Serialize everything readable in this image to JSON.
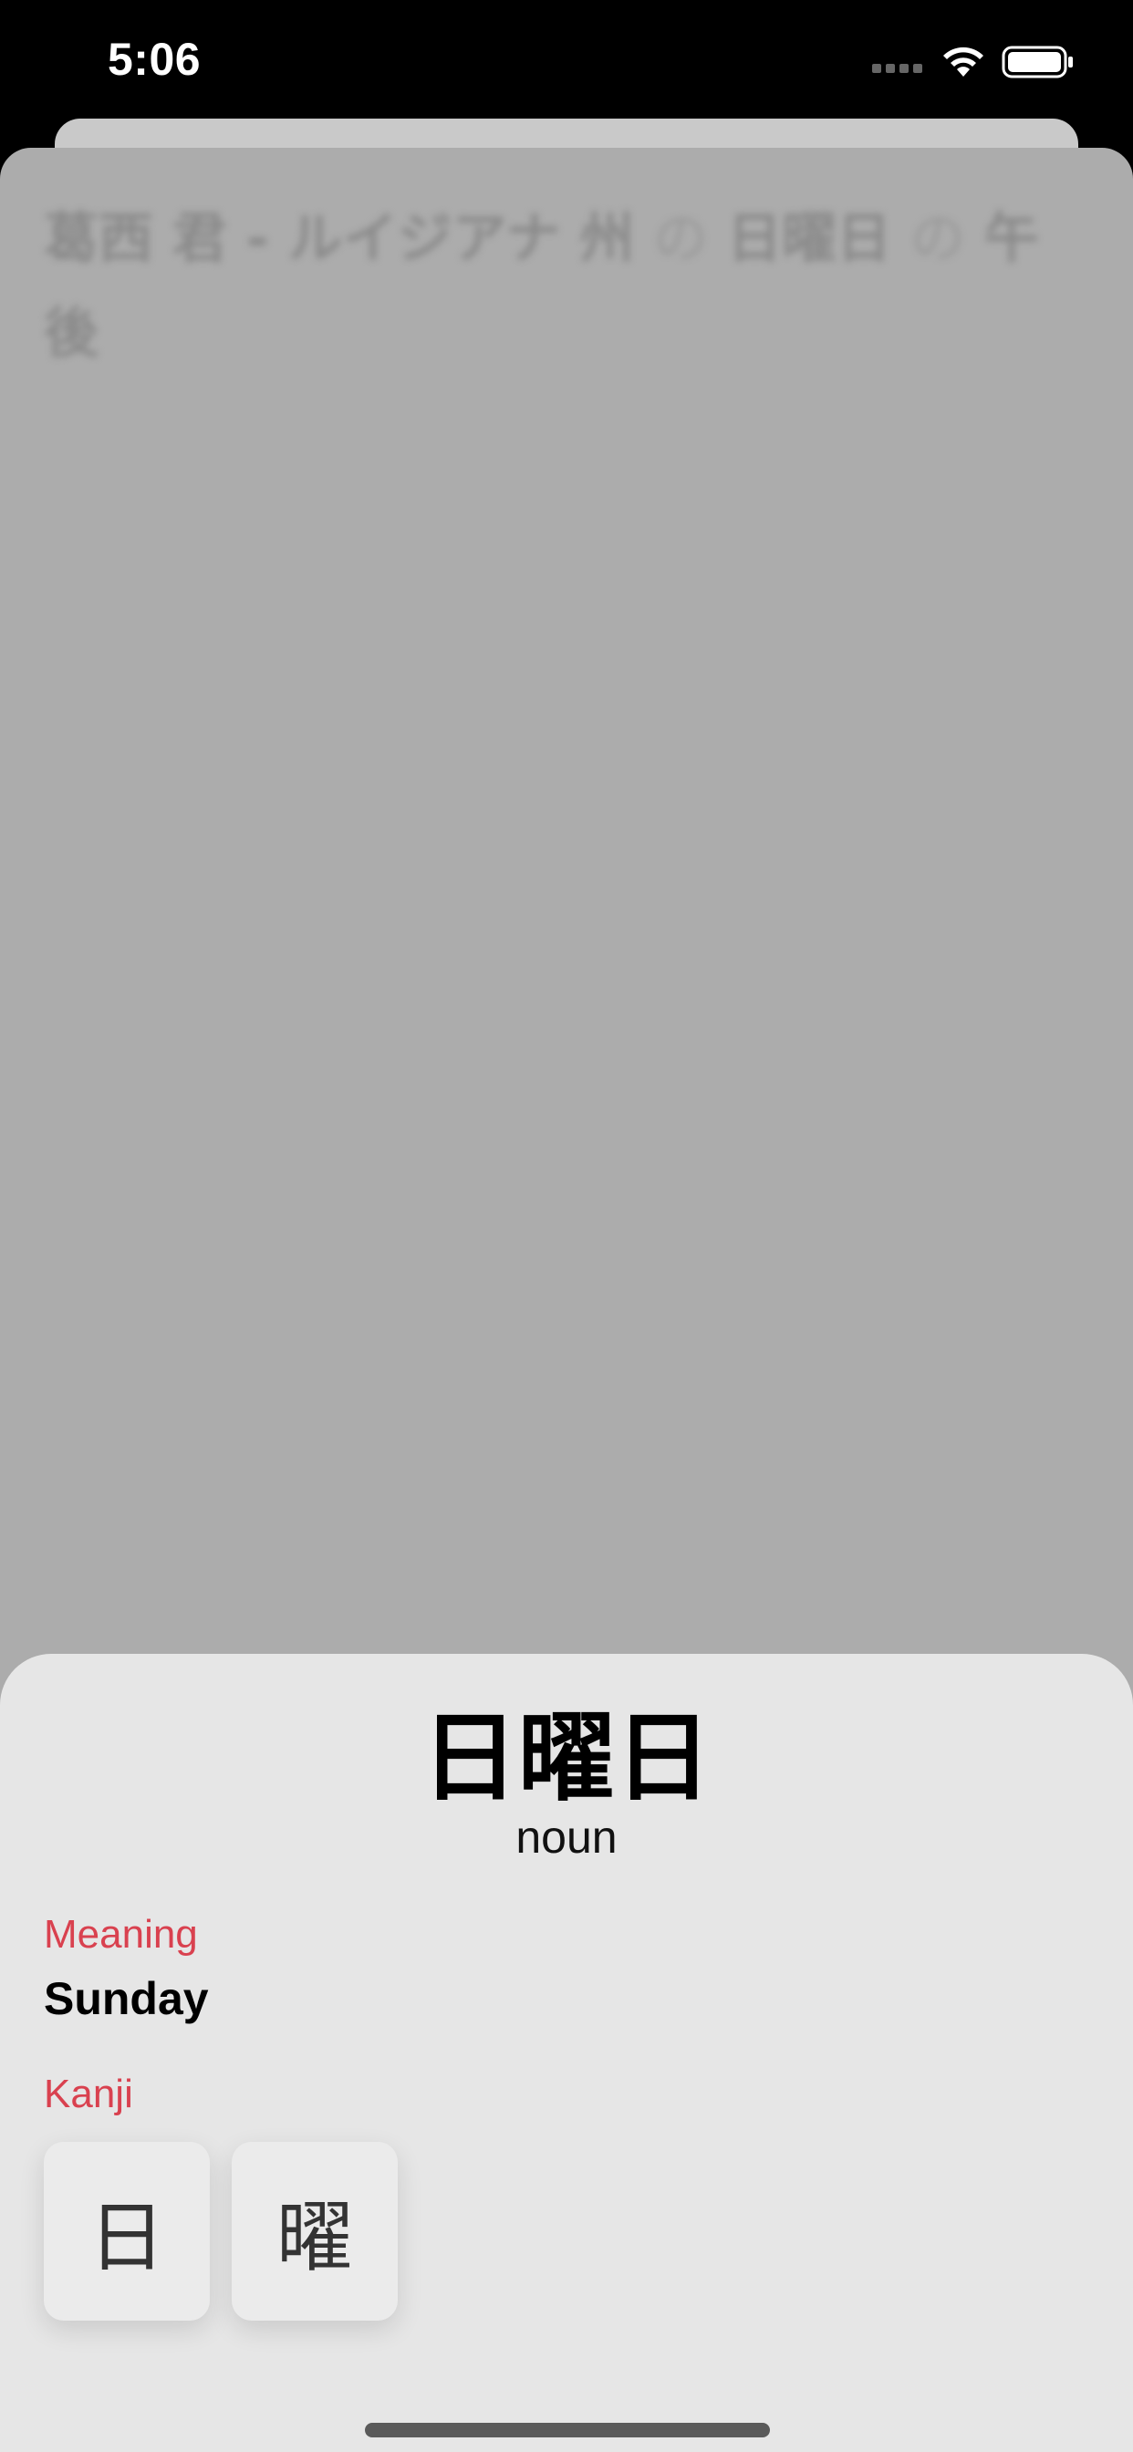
{
  "status_bar": {
    "time": "5:06",
    "icons": [
      "cellular-signal-icon",
      "wifi-icon",
      "battery-icon"
    ]
  },
  "background_card": {
    "sentence_tokens": [
      {
        "text": "葛西",
        "is_particle": false
      },
      {
        "text": "君",
        "is_particle": false
      },
      {
        "text": "-",
        "is_particle": false
      },
      {
        "text": "ルイジアナ",
        "is_particle": false
      },
      {
        "text": "州",
        "is_particle": false
      },
      {
        "text": "の",
        "is_particle": true
      },
      {
        "text": "日曜日",
        "is_particle": false
      },
      {
        "text": "の",
        "is_particle": true
      },
      {
        "text": "午後",
        "is_particle": false
      }
    ]
  },
  "detail_sheet": {
    "word": "日曜日",
    "part_of_speech": "noun",
    "meaning_label": "Meaning",
    "meaning": "Sunday",
    "kanji_label": "Kanji",
    "kanji": [
      "日",
      "曜"
    ]
  },
  "colors": {
    "accent": "#d9414f",
    "sheet_background": "#e6e6e6",
    "dim_background": "#acacac"
  }
}
